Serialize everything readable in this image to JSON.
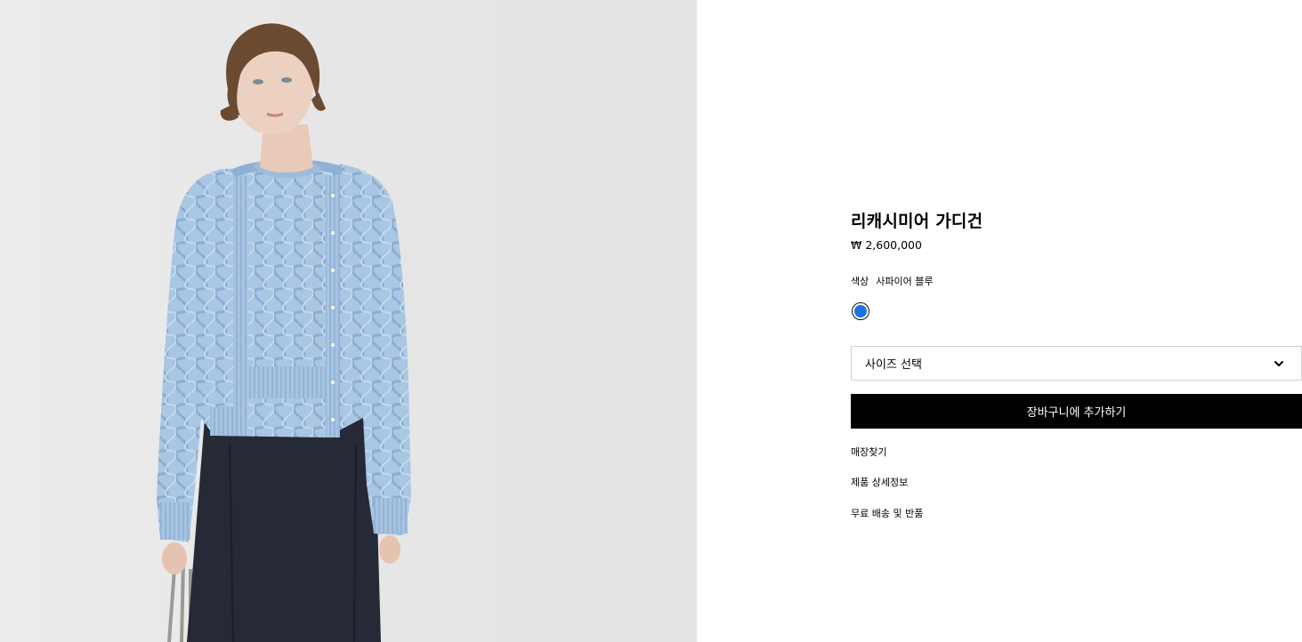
{
  "product": {
    "title": "리캐시미어 가디건",
    "price": "₩ 2,600,000",
    "color_label": "색상",
    "color_value": "사파이어 블루",
    "swatch_color": "#1b72e8",
    "size_select_placeholder": "사이즈 선택",
    "add_to_cart_label": "장바구니에 추가하기"
  },
  "links": [
    {
      "label": "매장찾기"
    },
    {
      "label": "제품 상세정보"
    },
    {
      "label": "무료 배송 및 반품"
    }
  ],
  "icons": {
    "size_chevron": "chevron-down-icon"
  }
}
